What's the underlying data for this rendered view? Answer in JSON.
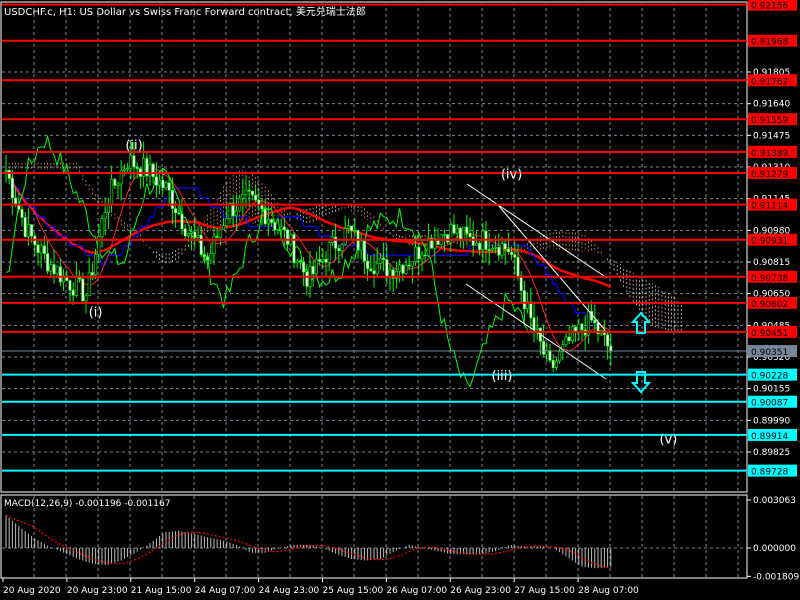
{
  "header": {
    "title": "USDCHF.c, H1:  US Dollar vs Swiss Franc Forward contract, 美元兑瑞士法郎"
  },
  "macd": {
    "label": "MACD(12,26,9) -0.001196 -0.001167",
    "ticks": [
      "0.003063",
      "0.000000",
      "-0.001809"
    ],
    "max": 0.003063,
    "min": -0.001809,
    "histogram": [
      0.0021,
      0.0013,
      0.0006,
      0.0001,
      -0.0003,
      -0.0007,
      -0.001,
      -0.0011,
      -0.0008,
      -0.0003,
      0.0003,
      0.001,
      0.0011,
      0.0009,
      0.0007,
      0.0005,
      0.0002,
      -0.0003,
      -0.0003,
      0.0,
      0.0002,
      0.0002,
      0.0,
      -0.0004,
      -0.0007,
      -0.0008,
      -0.0007,
      -0.0002,
      0.0002,
      0.0,
      -0.0002,
      -0.0004,
      -0.0004,
      -0.0004,
      -0.0002,
      0.0002,
      0.0001,
      0.0001,
      0.0,
      -0.0006,
      -0.0012,
      -0.0013,
      -0.0012
    ],
    "signal_color": "#ff0000",
    "hist_color": "#c0c0c0"
  },
  "chart_data": {
    "type": "candlestick",
    "symbol": "USDCHF.c",
    "timeframe": "H1",
    "price_ticks": [
      "0.91805",
      "0.91640",
      "0.91475",
      "0.91310",
      "0.91145",
      "0.90980",
      "0.90815",
      "0.90650",
      "0.90485",
      "0.90320",
      "0.90155",
      "0.89990",
      "0.89825"
    ],
    "time_ticks": [
      "20 Aug 2020",
      "20 Aug 23:00",
      "21 Aug 15:00",
      "24 Aug 07:00",
      "24 Aug 23:00",
      "25 Aug 15:00",
      "26 Aug 07:00",
      "26 Aug 23:00",
      "27 Aug 15:00",
      "28 Aug 07:00"
    ],
    "ylim": [
      0.8962,
      0.9219
    ],
    "close_anchors": [
      0.91294,
      0.90982,
      0.90825,
      0.90721,
      0.90643,
      0.91138,
      0.91346,
      0.91294,
      0.9119,
      0.90982,
      0.90825,
      0.91086,
      0.91138,
      0.9106,
      0.9093,
      0.90721,
      0.90878,
      0.90982,
      0.90825,
      0.90773,
      0.90825,
      0.9093,
      0.90982,
      0.9093,
      0.9093,
      0.90878,
      0.90513,
      0.90252,
      0.90409,
      0.90513,
      0.90351
    ],
    "current_price": "0.90351",
    "resistance_levels": [
      "0.92156",
      "0.91968",
      "0.91762",
      "0.91559",
      "0.91389",
      "0.91279",
      "0.91114",
      "0.90931",
      "0.90738",
      "0.90602",
      "0.90451"
    ],
    "support_levels": [
      "0.90228",
      "0.90087",
      "0.89914",
      "0.89728"
    ],
    "wave_labels": [
      {
        "text": "(i)",
        "price": 0.9053,
        "bar": 28
      },
      {
        "text": "(ii)",
        "price": 0.914,
        "bar": 40
      },
      {
        "text": "(iii)",
        "price": 0.902,
        "bar": 155
      },
      {
        "text": "(iv)",
        "price": 0.9125,
        "bar": 158
      },
      {
        "text": "(v)",
        "price": 0.8987,
        "bar": 207
      }
    ],
    "colors": {
      "bull": "#00ff00",
      "bear": "#ffffff",
      "resistance": "#ff0000",
      "support": "#00ffff",
      "current": "#778899",
      "grid": "#778899"
    }
  }
}
